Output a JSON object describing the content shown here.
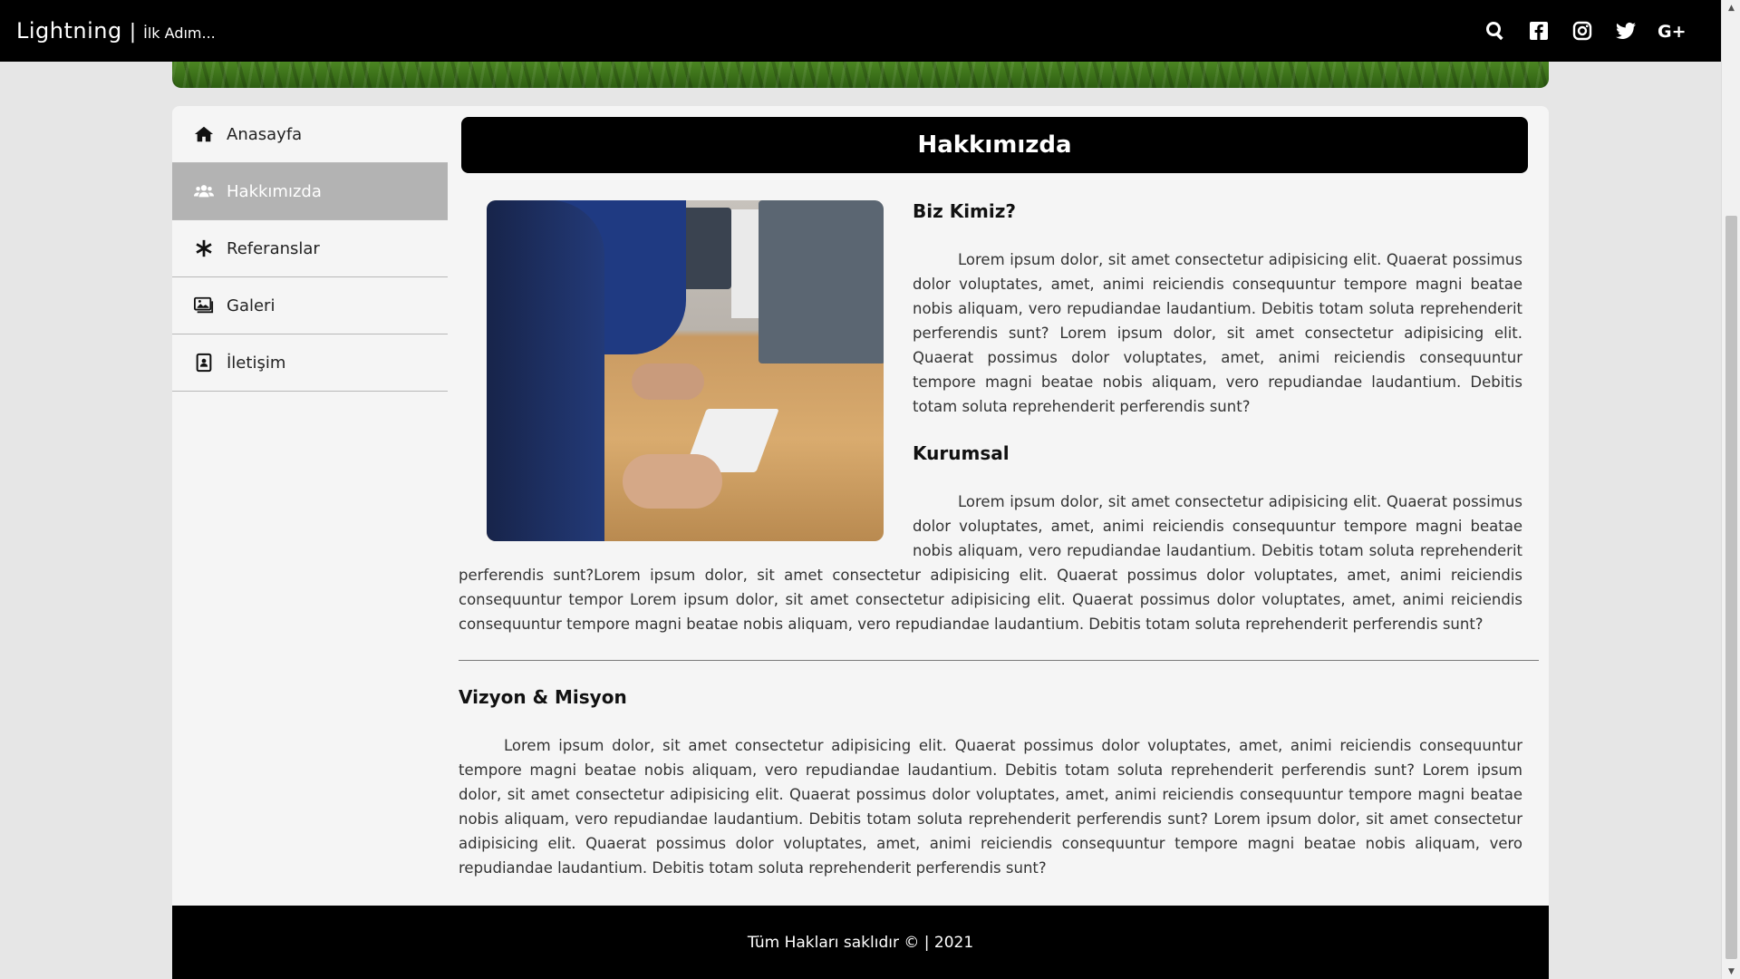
{
  "navbar": {
    "brand": "Lightning",
    "separator": "|",
    "tagline": "İlk Adım...",
    "icons": [
      "search-icon",
      "facebook-icon",
      "instagram-icon",
      "twitter-icon",
      "google-plus-icon"
    ]
  },
  "sidebar": {
    "items": [
      {
        "label": "Anasayfa",
        "icon": "home-icon",
        "active": false
      },
      {
        "label": "Hakkımızda",
        "icon": "users-icon",
        "active": true
      },
      {
        "label": "Referanslar",
        "icon": "asterisk-icon",
        "active": false
      },
      {
        "label": "Galeri",
        "icon": "images-icon",
        "active": false
      },
      {
        "label": "İletişim",
        "icon": "contact-card-icon",
        "active": false
      }
    ]
  },
  "content": {
    "title": "Hakkımızda",
    "section1_title": "Biz Kimiz?",
    "section1_text": "Lorem ipsum dolor, sit amet consectetur adipisicing elit. Quaerat possimus dolor voluptates, amet, animi reiciendis consequuntur tempore magni beatae nobis aliquam, vero repudiandae laudantium. Debitis totam soluta reprehenderit perferendis sunt? Lorem ipsum dolor, sit amet consectetur adipisicing elit. Quaerat possimus dolor voluptates, amet, animi reiciendis consequuntur tempore magni beatae nobis aliquam, vero repudiandae laudantium. Debitis totam soluta reprehenderit perferendis sunt?",
    "section2_title": "Kurumsal",
    "section2_text": "Lorem ipsum dolor, sit amet consectetur adipisicing elit. Quaerat possimus dolor voluptates, amet, animi reiciendis consequuntur tempore magni beatae nobis aliquam, vero repudiandae laudantium. Debitis totam soluta reprehenderit perferendis sunt?Lorem ipsum dolor, sit amet consectetur adipisicing elit. Quaerat possimus dolor voluptates, amet, animi reiciendis consequuntur tempor Lorem ipsum dolor, sit amet consectetur adipisicing elit. Quaerat possimus dolor voluptates, amet, animi reiciendis consequuntur tempore magni beatae nobis aliquam, vero repudiandae laudantium. Debitis totam soluta reprehenderit perferendis sunt?",
    "section3_title": "Vizyon & Misyon",
    "section3_text": "Lorem ipsum dolor, sit amet consectetur adipisicing elit. Quaerat possimus dolor voluptates, amet, animi reiciendis consequuntur tempore magni beatae nobis aliquam, vero repudiandae laudantium. Debitis totam soluta reprehenderit perferendis sunt? Lorem ipsum dolor, sit amet consectetur adipisicing elit. Quaerat possimus dolor voluptates, amet, animi reiciendis consequuntur tempore magni beatae nobis aliquam, vero repudiandae laudantium. Debitis totam soluta reprehenderit perferendis sunt? Lorem ipsum dolor, sit amet consectetur adipisicing elit. Quaerat possimus dolor voluptates, amet, animi reiciendis consequuntur tempore magni beatae nobis aliquam, vero repudiandae laudantium. Debitis totam soluta reprehenderit perferendis sunt?"
  },
  "footer": {
    "text": "Tüm Hakları saklıdır © | 2021"
  },
  "colors": {
    "navbar_bg": "#000000",
    "active_item_bg": "#b3b3b3",
    "page_bg": "#e6e6e6",
    "container_bg": "#f5f5f5"
  }
}
